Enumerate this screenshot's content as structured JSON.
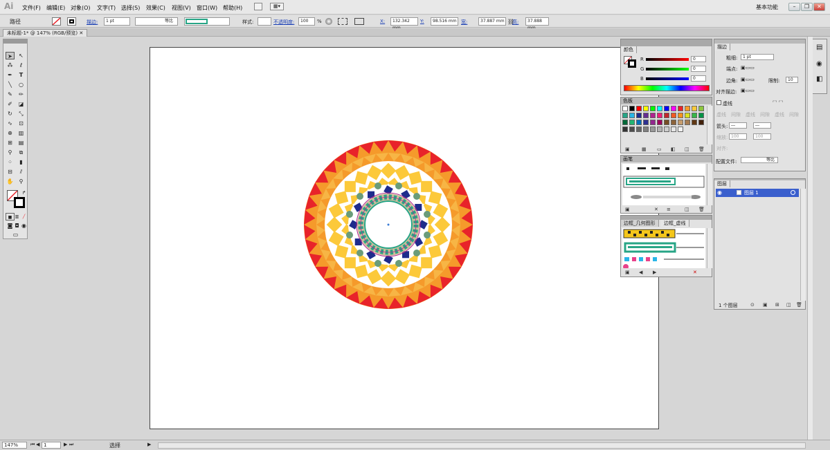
{
  "app": {
    "logo": "Ai",
    "workspace": "基本功能"
  },
  "menu": [
    "文件(F)",
    "编辑(E)",
    "对象(O)",
    "文字(T)",
    "选择(S)",
    "效果(C)",
    "视图(V)",
    "窗口(W)",
    "帮助(H)"
  ],
  "control": {
    "selection": "路径",
    "stroke_label": "描边:",
    "stroke_width": "1 pt",
    "stroke_profile": "等比",
    "style_label": "样式:",
    "opacity_label": "不透明度:",
    "opacity": "100",
    "opacity_unit": "%",
    "x_label": "X:",
    "x": "132.342 mm",
    "y_label": "Y:",
    "y": "98.516 mm",
    "w_label": "宽:",
    "w": "37.887 mm",
    "h_label": "高:",
    "h": "37.888 mm"
  },
  "document": {
    "tab": "未标题-1* @ 147% (RGB/预览)"
  },
  "colors": {
    "accent": "#e8232a",
    "orange": "#f59a2b",
    "yellow": "#fcc93a",
    "teal": "#27a586",
    "sage": "#6a9c7a",
    "navy": "#1e2c8c",
    "purple": "#b0238f"
  },
  "color_panel": {
    "title": "颜色",
    "r_label": "R",
    "g_label": "G",
    "b_label": "B",
    "r": "0",
    "g": "0",
    "b": "0"
  },
  "swatches_panel": {
    "title": "色板"
  },
  "brushes_panel": {
    "title": "画笔"
  },
  "symbol_panel": {
    "tabs": [
      "边框_几何图形",
      "边框_虚线"
    ]
  },
  "stroke_panel": {
    "title": "描边",
    "weight_label": "粗细:",
    "weight": "1 pt",
    "cap_label": "端点:",
    "corner_label": "边角:",
    "limit_label": "限制:",
    "limit": "10",
    "align_label": "对齐描边:",
    "dashed_label": "虚线",
    "dash_labels": [
      "虚线",
      "间隙",
      "虚线",
      "间隙",
      "虚线",
      "间隙"
    ],
    "arrow_label": "箭头:",
    "scale_label": "缩放:",
    "scale1": "100",
    "scale2": "100",
    "align2_label": "对齐:",
    "profile_label": "配置文件:",
    "profile": "等比"
  },
  "layers_panel": {
    "title": "图层",
    "layer_name": "图层 1",
    "count": "1 个图层"
  },
  "status": {
    "zoom": "147%",
    "page": "1",
    "tool": "选择"
  }
}
